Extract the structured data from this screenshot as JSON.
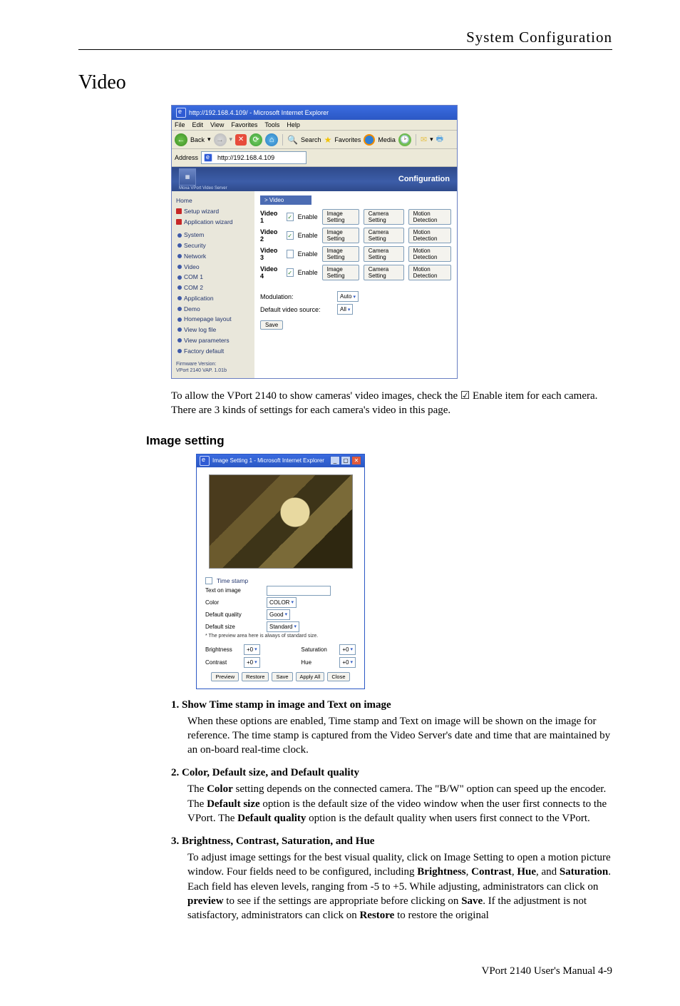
{
  "header": {
    "section": "System  Configuration"
  },
  "video": {
    "heading": "Video",
    "intro": "To allow the VPort 2140 to show cameras' video images, check the ☑ Enable item for each camera. There are 3 kinds of settings for each camera's video in this page."
  },
  "shot1": {
    "title": "http://192.168.4.109/ - Microsoft Internet Explorer",
    "menu": [
      "File",
      "Edit",
      "View",
      "Favorites",
      "Tools",
      "Help"
    ],
    "toolbar": {
      "back": "Back",
      "search": "Search",
      "favorites": "Favorites",
      "media": "Media"
    },
    "address_label": "Address",
    "address_value": "http://192.168.4.109",
    "banner": "Configuration",
    "banner_sub": "Moxa VPort Video Server",
    "sidebar": {
      "home": "Home",
      "setup_wizard": "Setup wizard",
      "app_wizard": "Application wizard",
      "items": [
        "System",
        "Security",
        "Network",
        "Video",
        "COM 1",
        "COM 2",
        "Application",
        "Demo",
        "Homepage layout",
        "View log file",
        "View parameters",
        "Factory default"
      ],
      "fw_label": "Firmware Version:",
      "fw_value": "VPort 2140 VAP. 1.01b"
    },
    "panel": {
      "section": "> Video",
      "rows": [
        {
          "label": "Video 1",
          "enabled": true
        },
        {
          "label": "Video 2",
          "enabled": true
        },
        {
          "label": "Video 3",
          "enabled": false
        },
        {
          "label": "Video 4",
          "enabled": true
        }
      ],
      "enable_label": "Enable",
      "btn_image": "Image Setting",
      "btn_camera": "Camera Setting",
      "btn_motion": "Motion Detection",
      "modulation_label": "Modulation:",
      "modulation_value": "Auto",
      "default_src_label": "Default video source:",
      "default_src_value": "All",
      "save": "Save"
    }
  },
  "image_setting": {
    "heading": "Image setting",
    "title": "Image Setting 1 - Microsoft Internet Explorer",
    "timestamp_label": "Time stamp",
    "text_on_image_label": "Text on image",
    "color_label": "Color",
    "color_value": "COLOR",
    "quality_label": "Default quality",
    "quality_value": "Good",
    "size_label": "Default size",
    "size_value": "Standard",
    "note": "* The preview area here is always of standard size.",
    "brightness_label": "Brightness",
    "contrast_label": "Contrast",
    "saturation_label": "Saturation",
    "hue_label": "Hue",
    "level": "+0",
    "buttons": {
      "preview": "Preview",
      "restore": "Restore",
      "save": "Save",
      "apply": "Apply All",
      "close": "Close"
    }
  },
  "items": {
    "i1": {
      "title": "1. Show Time stamp in image and Text on image",
      "body": "When these options are enabled, Time stamp and Text on image will be shown on the image for reference. The time stamp is captured from the Video Server's date and time that are maintained by an on-board real-time clock."
    },
    "i2": {
      "title": "2. Color, Default size, and Default quality",
      "pre": "The ",
      "t1": "Color",
      "mid1": " setting depends on the connected camera. The \"B/W\" option can speed up the encoder. The ",
      "t2": "Default size",
      "mid2": " option is the default size of the video window when the user first connects to the VPort. The ",
      "t3": "Default quality",
      "mid3": " option is the default quality when users first connect to the VPort."
    },
    "i3": {
      "title": "3. Brightness, Contrast, Saturation, and Hue",
      "p1": "To adjust image settings for the best visual quality, click on Image Setting to open a motion picture window. Four fields need to be configured, including ",
      "b1": "Brightness",
      "c1": ", ",
      "b2": "Contrast",
      "c2": ", ",
      "b3": "Hue",
      "c3": ", and ",
      "b4": "Saturation",
      "p2": ". Each field has eleven levels, ranging from -5 to +5. While adjusting, administrators can click on ",
      "b5": "preview",
      "p3": " to see if the settings are appropriate before clicking on ",
      "b6": "Save",
      "p4": ". If the adjustment is not satisfactory, administrators can click on ",
      "b7": "Restore",
      "p5": " to restore the original"
    }
  },
  "footer": "VPort  2140  User's Manual    4-9"
}
